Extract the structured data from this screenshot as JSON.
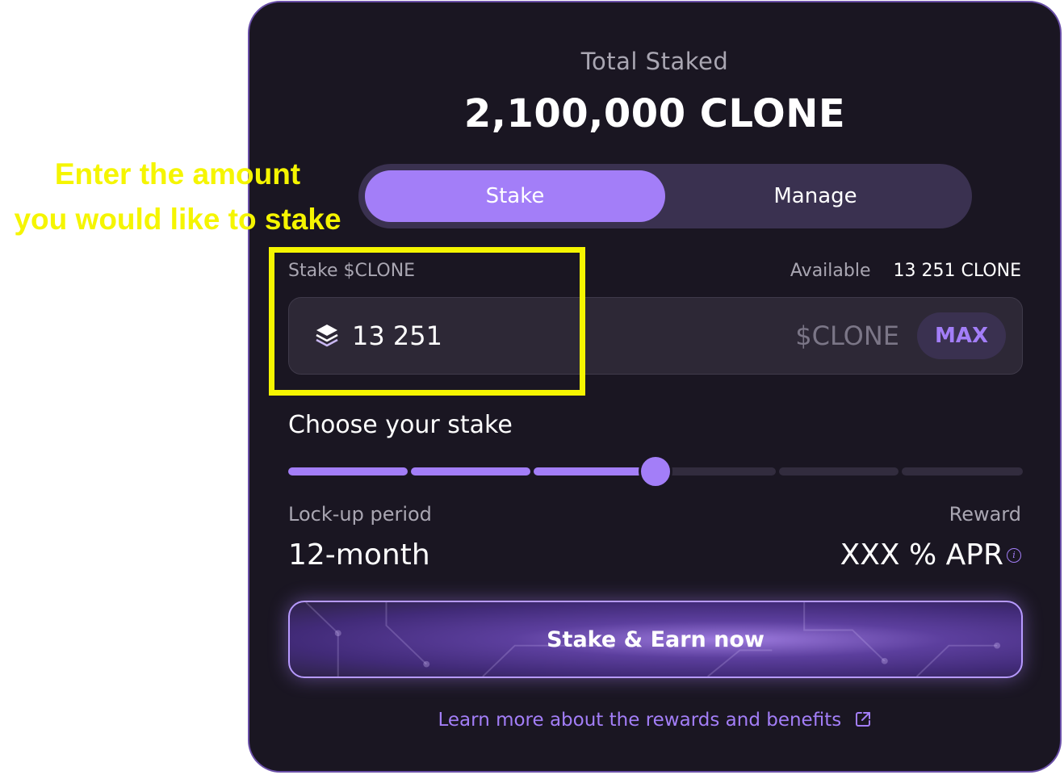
{
  "header": {
    "total_label": "Total Staked",
    "total_value": "2,100,000 CLONE"
  },
  "tabs": [
    {
      "label": "Stake",
      "active": true
    },
    {
      "label": "Manage",
      "active": false
    }
  ],
  "stake_field": {
    "label": "Stake $CLONE",
    "available_label": "Available",
    "available_value": "13 251 CLONE",
    "amount": "13 251",
    "unit": "$CLONE",
    "max_label": "MAX"
  },
  "slider": {
    "label": "Choose your stake",
    "steps": 6,
    "selected_step": 3
  },
  "lockup": {
    "label": "Lock-up period",
    "value": "12-month"
  },
  "reward": {
    "label": "Reward",
    "value": "XXX % APR"
  },
  "cta": {
    "label": "Stake & Earn now"
  },
  "learn_more": {
    "label": "Learn more about the rewards and benefits"
  },
  "annotation": {
    "line1": "Enter the amount",
    "line2": "you would like to stake"
  },
  "colors": {
    "accent": "#a37ef8",
    "card_bg": "#1a1622",
    "annotation": "#f5f500"
  }
}
